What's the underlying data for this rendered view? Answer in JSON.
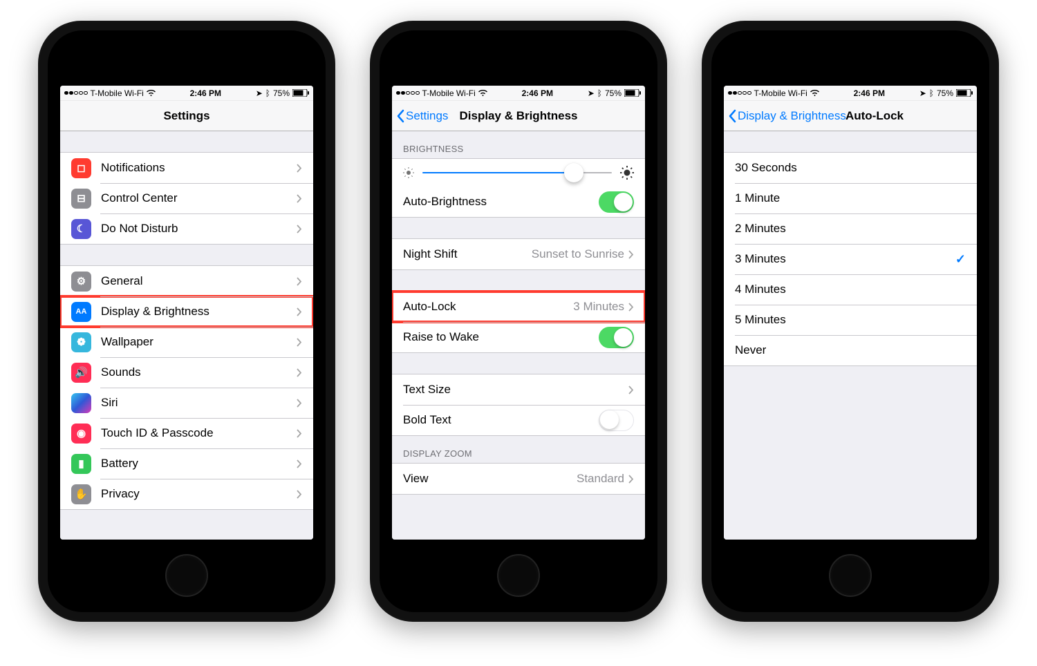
{
  "status": {
    "carrier": "T-Mobile Wi-Fi",
    "time": "2:46 PM",
    "battery": "75%"
  },
  "phone1": {
    "title": "Settings",
    "group1": [
      {
        "icon": "notifications-icon",
        "bg": "bg-red",
        "glyph": "◻︎",
        "label": "Notifications"
      },
      {
        "icon": "control-center-icon",
        "bg": "bg-gray",
        "glyph": "⊟",
        "label": "Control Center"
      },
      {
        "icon": "do-not-disturb-icon",
        "bg": "bg-purple",
        "glyph": "☾",
        "label": "Do Not Disturb"
      }
    ],
    "group2": [
      {
        "icon": "general-icon",
        "bg": "bg-gray",
        "glyph": "⚙︎",
        "label": "General"
      },
      {
        "icon": "display-brightness-icon",
        "bg": "bg-blue",
        "glyph": "AA",
        "label": "Display & Brightness",
        "highlight": true
      },
      {
        "icon": "wallpaper-icon",
        "bg": "bg-cyan",
        "glyph": "❁",
        "label": "Wallpaper"
      },
      {
        "icon": "sounds-icon",
        "bg": "bg-pink",
        "glyph": "🔊",
        "label": "Sounds"
      },
      {
        "icon": "siri-icon",
        "bg": "bg-black",
        "glyph": "",
        "label": "Siri"
      },
      {
        "icon": "touch-id-icon",
        "bg": "bg-pink",
        "glyph": "◉",
        "label": "Touch ID & Passcode"
      },
      {
        "icon": "battery-icon",
        "bg": "bg-green",
        "glyph": "▮",
        "label": "Battery"
      },
      {
        "icon": "privacy-icon",
        "bg": "bg-gray",
        "glyph": "✋",
        "label": "Privacy"
      }
    ]
  },
  "phone2": {
    "back": "Settings",
    "title": "Display & Brightness",
    "section_brightness": "BRIGHTNESS",
    "auto_brightness": "Auto-Brightness",
    "night_shift": "Night Shift",
    "night_shift_value": "Sunset to Sunrise",
    "auto_lock": "Auto-Lock",
    "auto_lock_value": "3 Minutes",
    "raise_to_wake": "Raise to Wake",
    "text_size": "Text Size",
    "bold_text": "Bold Text",
    "section_zoom": "DISPLAY ZOOM",
    "view": "View",
    "view_value": "Standard"
  },
  "phone3": {
    "back": "Display & Brightness",
    "title": "Auto-Lock",
    "options": [
      {
        "label": "30 Seconds",
        "checked": false
      },
      {
        "label": "1 Minute",
        "checked": false
      },
      {
        "label": "2 Minutes",
        "checked": false
      },
      {
        "label": "3 Minutes",
        "checked": true
      },
      {
        "label": "4 Minutes",
        "checked": false
      },
      {
        "label": "5 Minutes",
        "checked": false
      },
      {
        "label": "Never",
        "checked": false
      }
    ]
  }
}
